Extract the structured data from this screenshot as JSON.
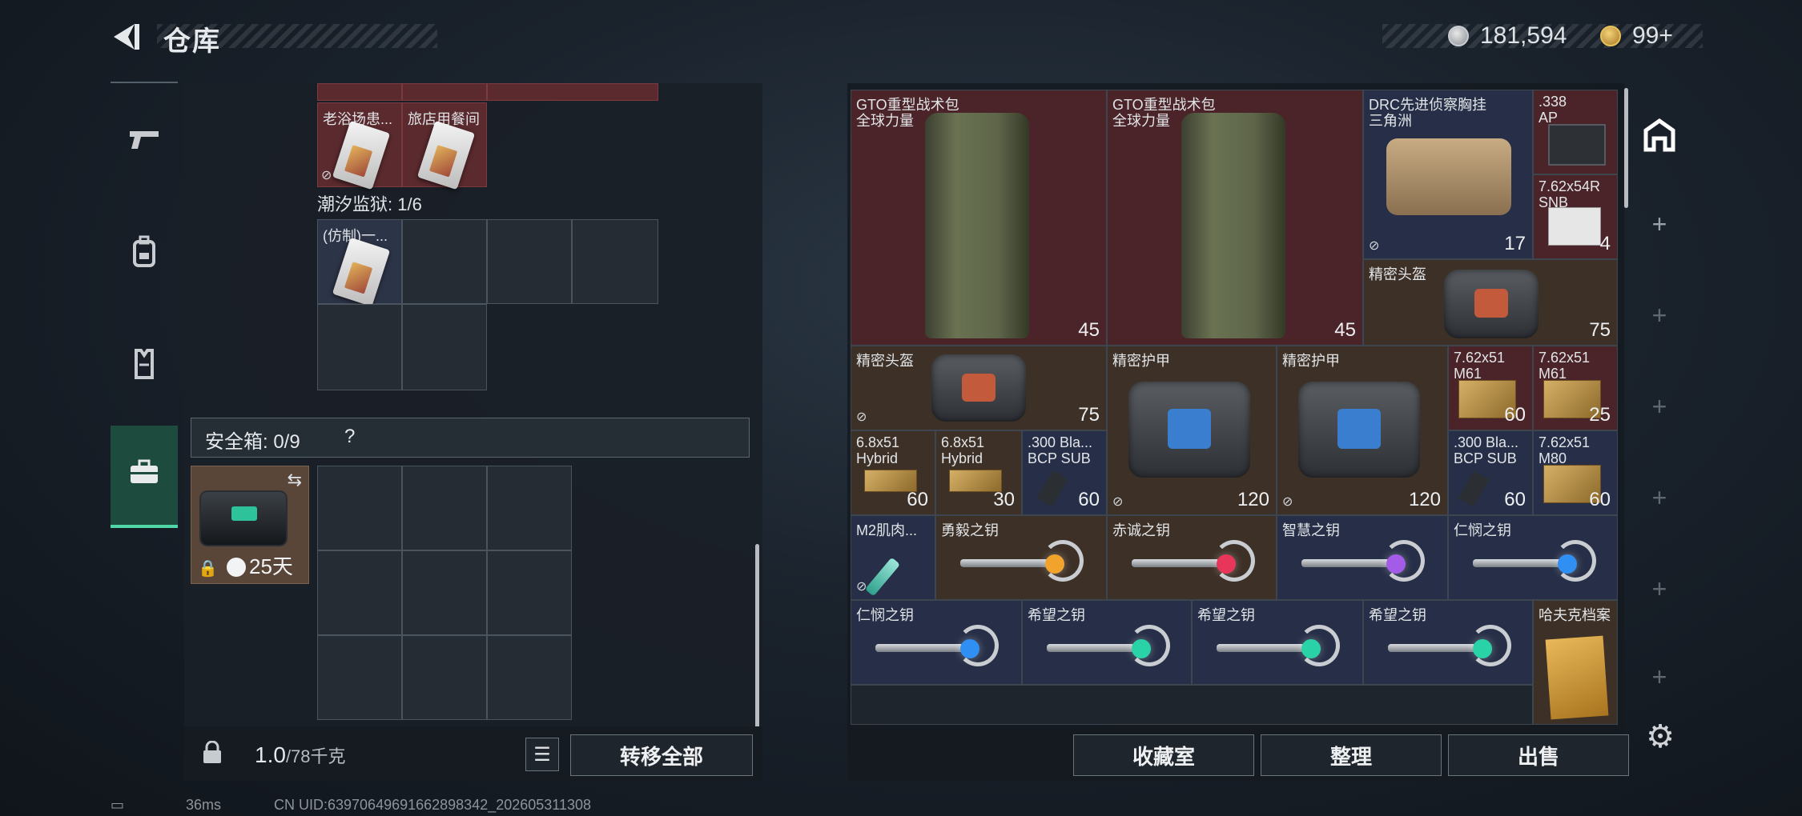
{
  "header": {
    "title": "仓库",
    "coins": "181,594",
    "gems": "99+"
  },
  "left_tabs": [
    {
      "name": "tab-weapons",
      "icon": "pistol-icon"
    },
    {
      "name": "tab-gear",
      "icon": "backpack-icon"
    },
    {
      "name": "tab-armor",
      "icon": "vest-icon"
    },
    {
      "name": "tab-safebox",
      "icon": "briefcase-icon"
    }
  ],
  "left_panel": {
    "items": [
      "老浴场患...",
      "旅店用餐间"
    ],
    "prison_label": "潮汐监狱: 1/6",
    "prison_item": "(仿制)一...",
    "safe_label": "安全箱: 0/9",
    "safe_help": "?",
    "safebox_time": "25天",
    "weight_value": "1.0",
    "weight_unit": "/78千克",
    "transfer_all": "转移全部"
  },
  "stash": {
    "backpack1": {
      "l1": "GTO重型战术包",
      "l2": "全球力量",
      "dur": "45"
    },
    "backpack2": {
      "l1": "GTO重型战术包",
      "l2": "全球力量",
      "dur": "45"
    },
    "chestrig": {
      "l1": "DRC先进侦察胸挂",
      "l2": "三角洲",
      "dur": "17"
    },
    "ammo338": {
      "l1": ".338",
      "l2": "AP"
    },
    "ammo762snp": {
      "l1": "7.62x54R",
      "l2": "SNB",
      "qty": "4"
    },
    "helmet1": {
      "l1": "精密头盔",
      "dur": "75"
    },
    "helmet2": {
      "l1": "精密头盔",
      "dur": "75"
    },
    "armor1": {
      "l1": "精密护甲",
      "dur": "120"
    },
    "armor2": {
      "l1": "精密护甲",
      "dur": "120"
    },
    "m61a": {
      "l1": "7.62x51",
      "l2": "M61",
      "qty": "60"
    },
    "m61b": {
      "l1": "7.62x51",
      "l2": "M61",
      "qty": "25"
    },
    "hybrid1": {
      "l1": "6.8x51",
      "l2": "Hybrid",
      "qty": "60"
    },
    "hybrid2": {
      "l1": "6.8x51",
      "l2": "Hybrid",
      "qty": "30"
    },
    "blk1": {
      "l1": ".300 Bla...",
      "l2": "BCP SUB",
      "qty": "60"
    },
    "blk2": {
      "l1": ".300 Bla...",
      "l2": "BCP SUB",
      "qty": "60"
    },
    "m80": {
      "l1": "7.62x51",
      "l2": "M80",
      "qty": "60"
    },
    "syringe": {
      "l1": "M2肌肉..."
    },
    "key_brave": {
      "l1": "勇毅之钥"
    },
    "key_red": {
      "l1": "赤诚之钥"
    },
    "key_wise": {
      "l1": "智慧之钥"
    },
    "key_kind1": {
      "l1": "仁悯之钥"
    },
    "key_kind2": {
      "l1": "仁悯之钥"
    },
    "key_hope1": {
      "l1": "希望之钥"
    },
    "key_hope2": {
      "l1": "希望之钥"
    },
    "key_hope3": {
      "l1": "希望之钥"
    },
    "file": {
      "l1": "哈夫克档案"
    }
  },
  "buttons": {
    "collection": "收藏室",
    "sort": "整理",
    "sell": "出售"
  },
  "status": {
    "ping": "36ms",
    "uid": "CN UID:63970649691662898342_202605311308"
  },
  "colors": {
    "accent": "#4fd7a8",
    "red_cell": "#4a2428",
    "blue_cell": "#262f47",
    "brown_cell": "#3d3026"
  }
}
